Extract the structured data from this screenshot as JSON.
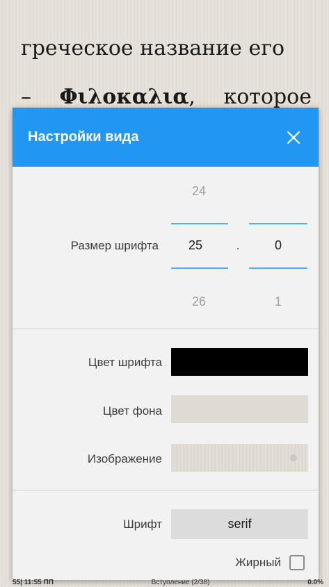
{
  "book": {
    "line1": "греческое название его",
    "line2_dash": "–",
    "line2_bold": "Φιλοκαλια",
    "line2_comma": ",",
    "line2_rest": "которое"
  },
  "dialog": {
    "title": "Настройки вида",
    "close_icon": "close-icon",
    "font_size": {
      "label": "Размер шрифта",
      "int_prev": "24",
      "int_current": "25",
      "int_next": "26",
      "separator": ".",
      "frac_prev": "",
      "frac_current": "0",
      "frac_next": "1"
    },
    "font_color": {
      "label": "Цвет шрифта",
      "value": "#000000"
    },
    "bg_color": {
      "label": "Цвет фона",
      "value": "#e0dbd2"
    },
    "image": {
      "label": "Изображение"
    },
    "font": {
      "label": "Шрифт",
      "value": "serif"
    },
    "bold": {
      "label": "Жирный",
      "checked": false
    }
  },
  "status_bar": {
    "left": "55| 11:55 ПП",
    "center": "Вступление (2/38)",
    "right": "0.0%"
  },
  "colors": {
    "accent": "#2196f3",
    "picker_line": "#4fb0ea"
  }
}
